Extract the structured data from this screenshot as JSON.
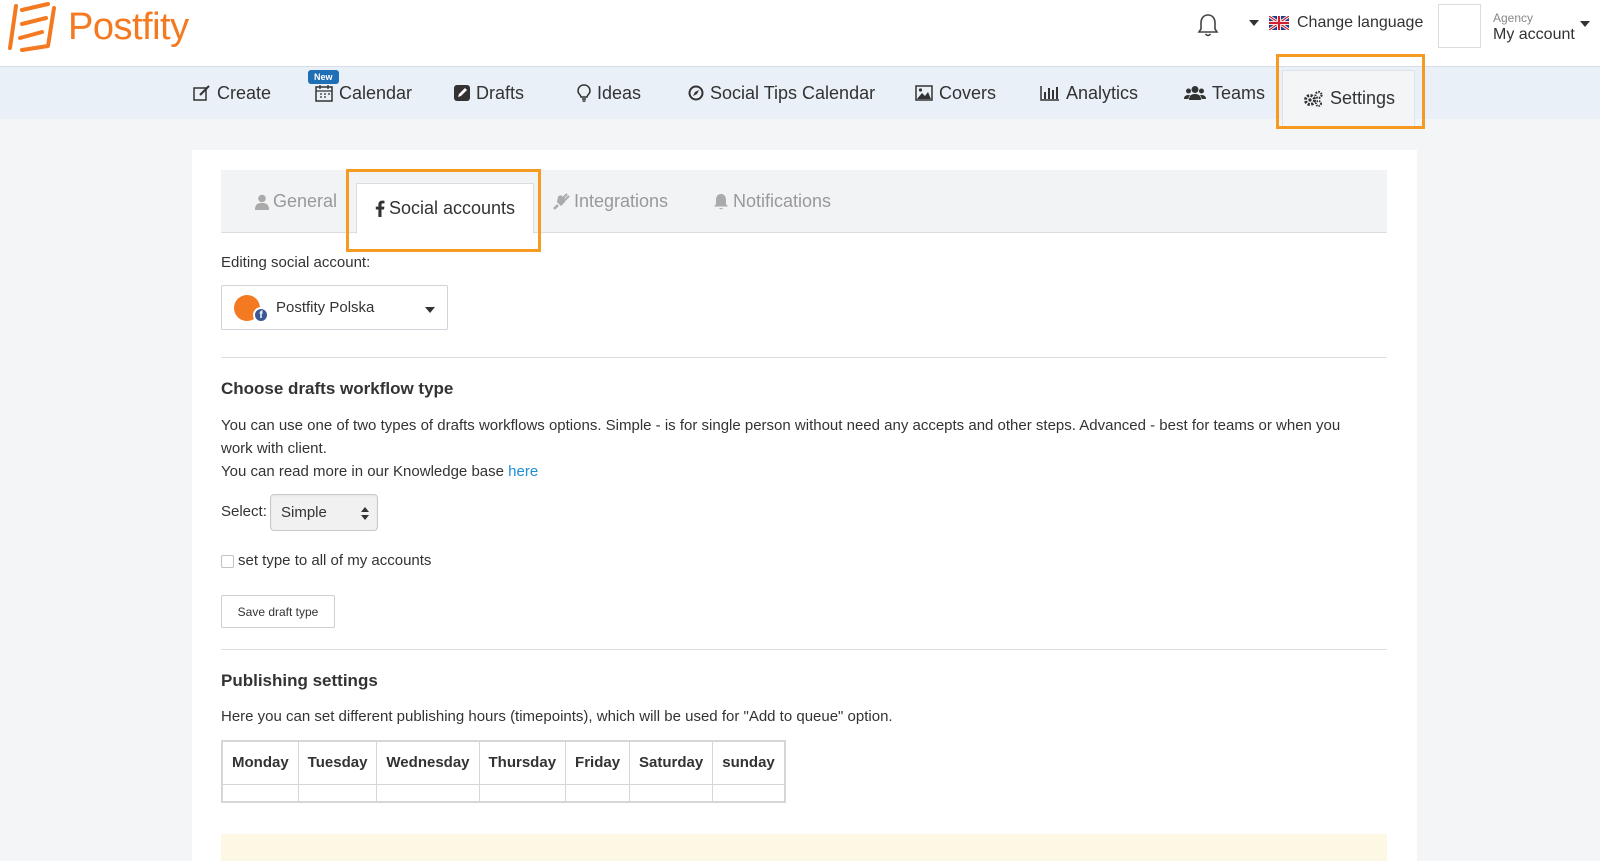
{
  "app": {
    "name": "Postfity",
    "brand_color": "#f47a22",
    "highlight_color": "#f59a23",
    "link_color": "#1f8fd6"
  },
  "header": {
    "change_language": "Change language",
    "account_role": "Agency",
    "account_label": "My account"
  },
  "nav": {
    "items": [
      {
        "label": "Create",
        "icon": "edit-icon"
      },
      {
        "label": "Calendar",
        "icon": "calendar-icon",
        "badge": "New"
      },
      {
        "label": "Drafts",
        "icon": "drafts-icon"
      },
      {
        "label": "Ideas",
        "icon": "lightbulb-icon"
      },
      {
        "label": "Social Tips Calendar",
        "icon": "compass-icon"
      },
      {
        "label": "Covers",
        "icon": "image-icon"
      },
      {
        "label": "Analytics",
        "icon": "bar-chart-icon"
      },
      {
        "label": "Teams",
        "icon": "users-icon"
      },
      {
        "label": "Settings",
        "icon": "gears-icon",
        "active": true
      }
    ]
  },
  "settings_tabs": [
    {
      "label": "General",
      "icon": "user-icon"
    },
    {
      "label": "Social accounts",
      "icon": "facebook-icon",
      "active": true
    },
    {
      "label": "Integrations",
      "icon": "plug-icon"
    },
    {
      "label": "Notifications",
      "icon": "bell-icon"
    }
  ],
  "editing": {
    "label": "Editing social account:",
    "selected_account": "Postfity Polska"
  },
  "drafts_workflow": {
    "title": "Choose drafts workflow type",
    "description_line1": "You can use one of two types of drafts workflows options. Simple - is for single person without need any accepts and other steps. Advanced - best for teams or when you",
    "description_line2": "work with client.",
    "kb_text": "You can read more in our Knowledge base",
    "kb_link": "here",
    "select_label": "Select:",
    "select_value": "Simple",
    "checkbox_label": "set type to all of my accounts",
    "checkbox_checked": false,
    "save_button": "Save draft type"
  },
  "publishing": {
    "title": "Publishing settings",
    "description": "Here you can set different publishing hours (timepoints), which will be used for \"Add to queue\" option.",
    "days": [
      "Monday",
      "Tuesday",
      "Wednesday",
      "Thursday",
      "Friday",
      "Saturday",
      "sunday"
    ]
  }
}
